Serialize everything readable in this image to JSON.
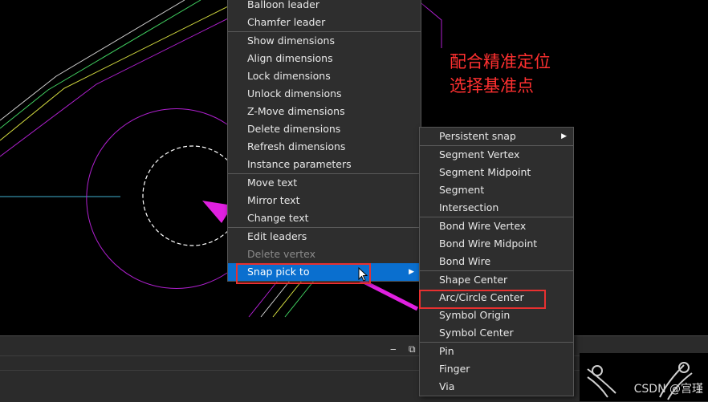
{
  "main_menu": {
    "groups": [
      [
        "Balloon leader",
        "Chamfer leader"
      ],
      [
        "Show dimensions",
        "Align dimensions",
        "Lock dimensions",
        "Unlock dimensions",
        "Z-Move dimensions",
        "Delete dimensions",
        "Refresh dimensions",
        "Instance parameters"
      ],
      [
        "Move text",
        "Mirror text",
        "Change text"
      ],
      [
        "Edit leaders",
        "Delete vertex",
        "Snap pick to"
      ]
    ],
    "disabled": [
      "Delete vertex"
    ],
    "active": "Snap pick to"
  },
  "sub_menu": {
    "groups": [
      [
        "Persistent snap"
      ],
      [
        "Segment Vertex",
        "Segment Midpoint",
        "Segment",
        "Intersection"
      ],
      [
        "Bond Wire Vertex",
        "Bond Wire Midpoint",
        "Bond Wire"
      ],
      [
        "Shape Center",
        "Arc/Circle Center",
        "Symbol Origin",
        "Symbol Center"
      ],
      [
        "Pin",
        "Finger",
        "Via"
      ]
    ],
    "has_submenu": [
      "Persistent snap"
    ]
  },
  "annotation": {
    "line1": "配合精准定位",
    "line2": "选择基准点",
    "color": "#ff3030"
  },
  "window_controls": {
    "minimize": "‒",
    "restore": "⧉"
  },
  "watermark": "CSDN @宫瑾",
  "colors": {
    "menu_bg": "#2e2e2e",
    "highlight": "#0a6fcf",
    "arrow": "#e020e0",
    "canvas_bg": "#000000"
  }
}
